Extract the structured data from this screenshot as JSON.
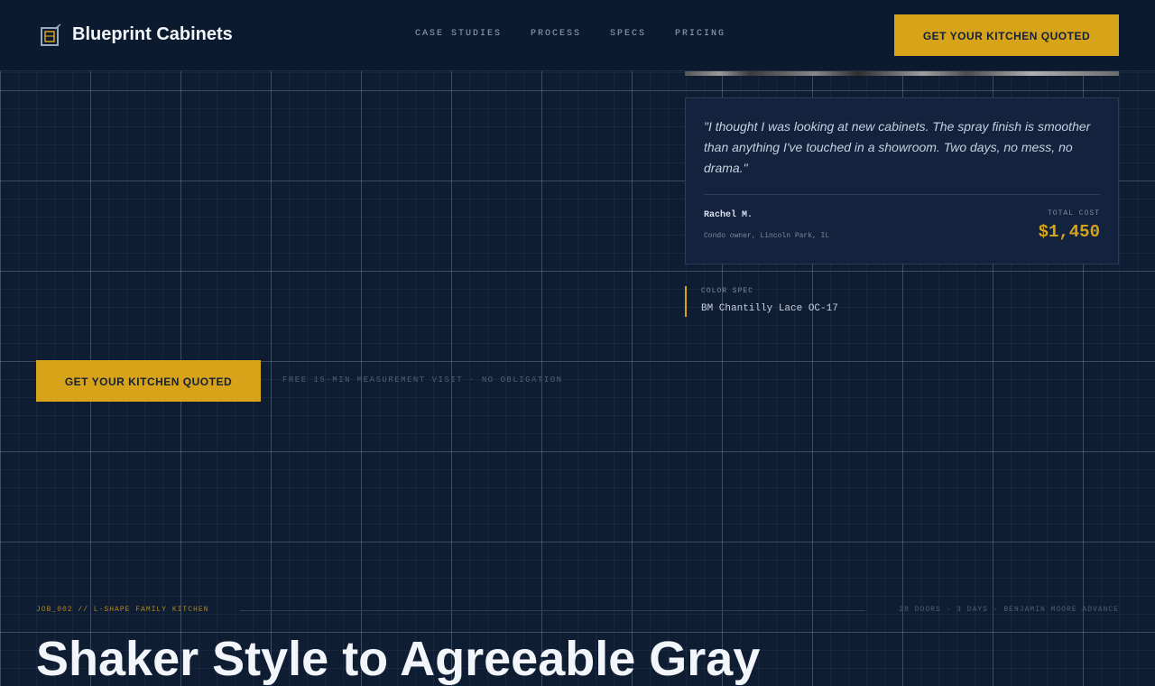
{
  "header": {
    "brand": "Blueprint Cabinets",
    "nav": [
      "CASE STUDIES",
      "PROCESS",
      "SPECS",
      "PRICING"
    ],
    "cta": "GET YOUR KITCHEN QUOTED"
  },
  "testimonial": {
    "quote": "\"I thought I was looking at new cabinets. The spray finish is smoother than anything I've touched in a showroom. Two days, no mess, no drama.\"",
    "author": "Rachel M.",
    "location": "Condo owner, Lincoln Park, IL",
    "cost_label": "TOTAL COST",
    "cost_value": "$1,450"
  },
  "color_spec": {
    "label": "COLOR SPEC",
    "value": "BM Chantilly Lace OC-17"
  },
  "cta": {
    "button": "GET YOUR KITCHEN QUOTED",
    "note": "FREE 15-MIN MEASUREMENT VISIT · NO OBLIGATION"
  },
  "job": {
    "id": "JOB_002 // L-SHAPE FAMILY KITCHEN",
    "specs": "28 DOORS · 3 DAYS · BENJAMIN MOORE ADVANCE",
    "title": "Shaker Style to Agreeable Gray"
  },
  "colors": {
    "accent": "#d6a319",
    "background": "#0f1d33",
    "card": "#13223d"
  }
}
